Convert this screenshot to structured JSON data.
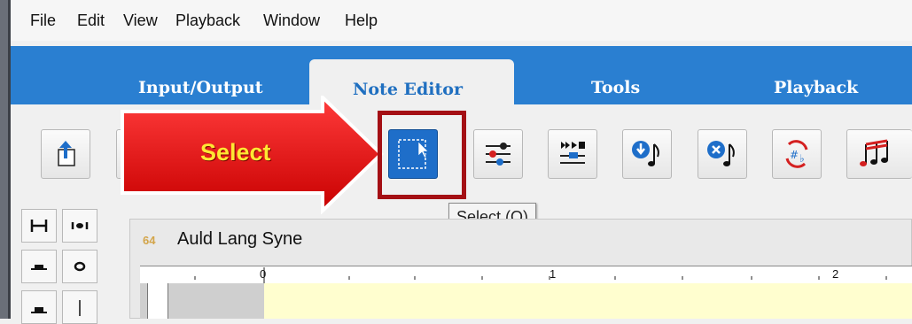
{
  "menu": [
    "File",
    "Edit",
    "View",
    "Playback",
    "Window",
    "Help"
  ],
  "ribbon_tabs": [
    {
      "label": "Input/Output",
      "active": false
    },
    {
      "label": "Note Editor",
      "active": true
    },
    {
      "label": "Tools",
      "active": false
    },
    {
      "label": "Playback",
      "active": false
    }
  ],
  "callout": {
    "label": "Select"
  },
  "tooltip": {
    "text": "Select (O)"
  },
  "document": {
    "title": "Auld Lang Syne"
  },
  "ruler": {
    "marks": [
      "0",
      "1",
      "2"
    ]
  },
  "colors": {
    "ribbon": "#2a7fd1",
    "highlight": "#a40f14",
    "arrow": "#e60000",
    "callout_text": "#ffe733",
    "score_bg": "#fffecf"
  }
}
